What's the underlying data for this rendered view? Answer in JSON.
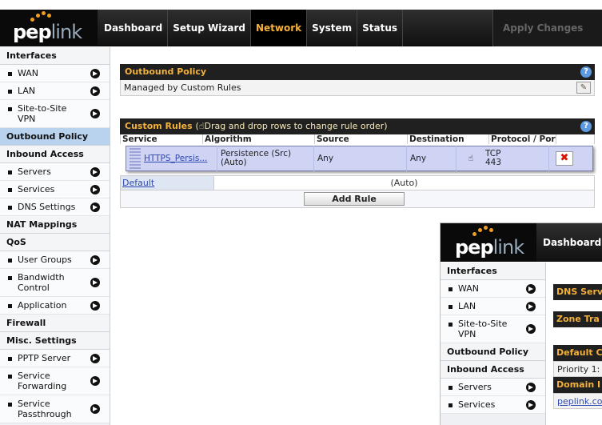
{
  "header": {
    "logo_text": "pep",
    "logo_text_accent": "link",
    "nav": [
      "Dashboard",
      "Setup Wizard",
      "Network",
      "System",
      "Status"
    ],
    "active_nav": "Network",
    "apply_label": "Apply Changes"
  },
  "sidebar": {
    "interfaces": {
      "title": "Interfaces",
      "items": [
        "WAN",
        "LAN",
        "Site-to-Site VPN"
      ]
    },
    "outbound": "Outbound Policy",
    "inbound": {
      "title": "Inbound Access",
      "items": [
        "Servers",
        "Services",
        "DNS Settings"
      ]
    },
    "nat": "NAT Mappings",
    "qos": {
      "title": "QoS",
      "items": [
        "User Groups",
        "Bandwidth Control",
        "Application"
      ]
    },
    "firewall": "Firewall",
    "misc": {
      "title": "Misc. Settings",
      "items": [
        "PPTP Server",
        "Service Forwarding",
        "Service Passthrough"
      ]
    }
  },
  "outbound_policy": {
    "title": "Outbound Policy",
    "value": "Managed by Custom Rules",
    "help": "?"
  },
  "custom_rules": {
    "title": "Custom Rules",
    "hint": "Drag and drop rows to change rule order",
    "columns": [
      "Service",
      "Algorithm",
      "Source",
      "Destination",
      "Protocol / Port"
    ],
    "rule": {
      "service": "HTTPS_Persis...",
      "algorithm": "Persistence (Src) (Auto)",
      "source": "Any",
      "destination": "Any",
      "protocol": "TCP",
      "port": "443"
    },
    "default_label": "Default",
    "default_value": "(Auto)",
    "add_label": "Add Rule",
    "delete_symbol": "✖"
  },
  "overlay": {
    "nav_label": "Dashboard",
    "sidebar": {
      "interfaces": {
        "title": "Interfaces",
        "items": [
          "WAN",
          "LAN",
          "Site-to-Site VPN"
        ]
      },
      "outbound": "Outbound Policy",
      "inbound": {
        "title": "Inbound Access",
        "items": [
          "Servers",
          "Services"
        ]
      }
    },
    "main": {
      "bar1": "DNS Serv",
      "bar2": "Zone Tra",
      "bar3": "Default C",
      "cell1": "Priority 1:",
      "bar4": "Domain I",
      "link": "peplink.co"
    }
  },
  "colors": {
    "accent": "#f3b13b",
    "active_sidebar": "#b9d3ef",
    "header_bg": "#202020",
    "link": "#3049b0"
  }
}
